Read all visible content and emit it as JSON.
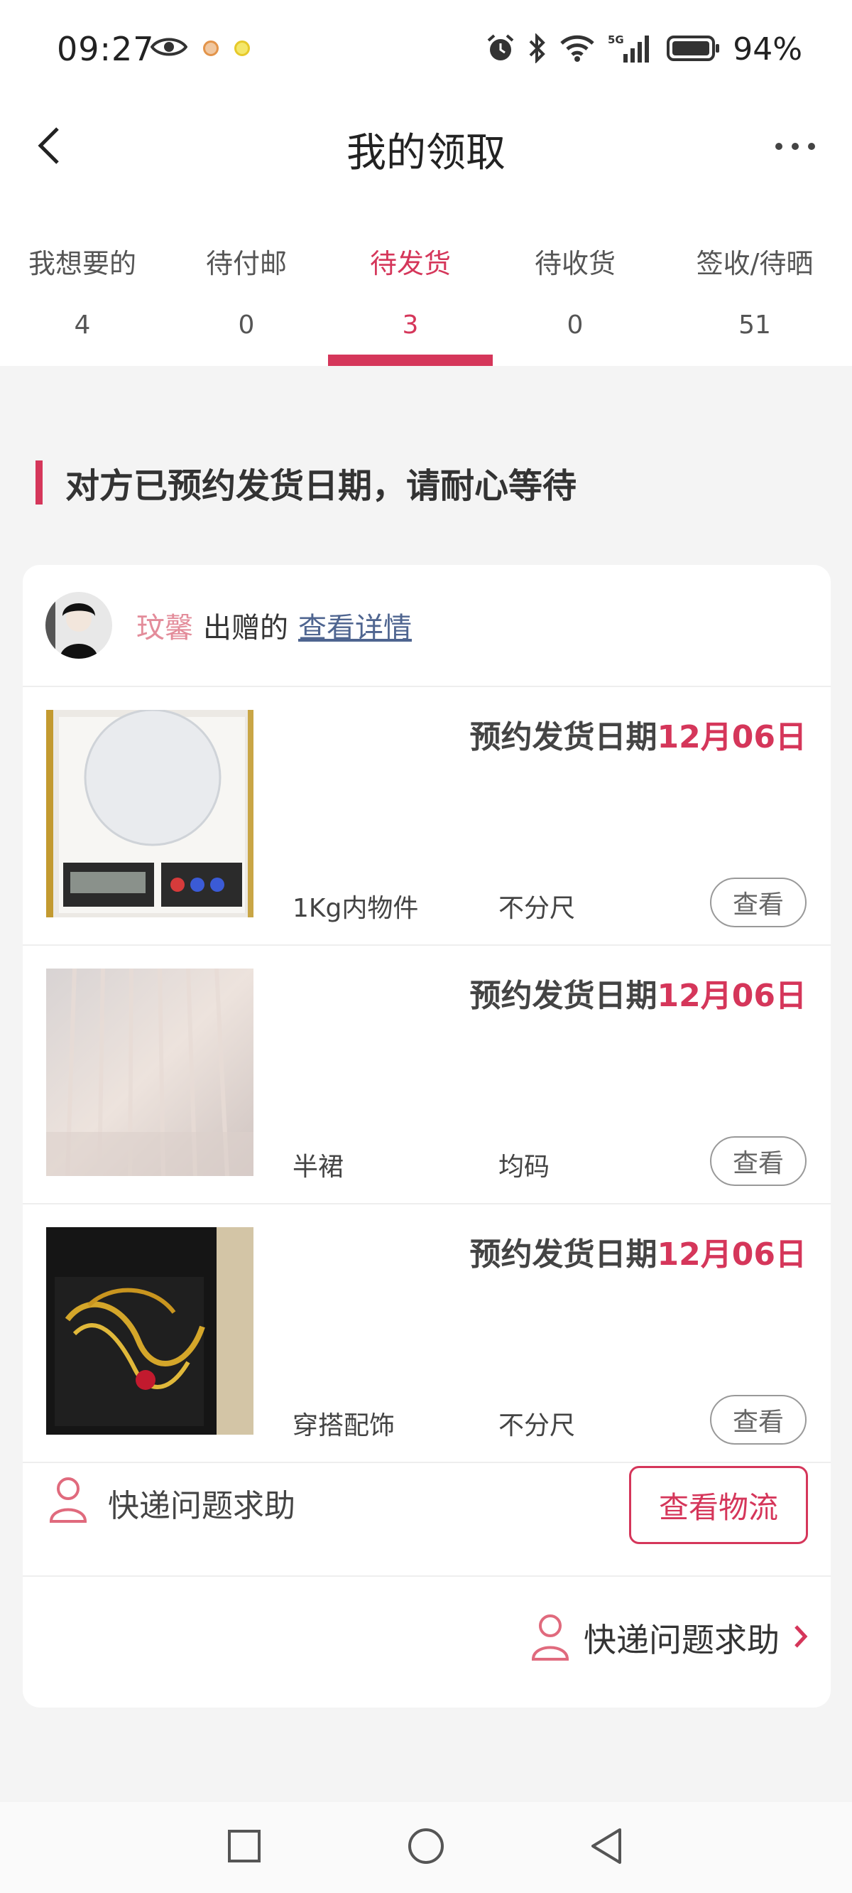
{
  "status_bar": {
    "time": "09:27",
    "battery": "94%",
    "network": "5G"
  },
  "header": {
    "title": "我的领取"
  },
  "tabs": [
    {
      "label": "我想要的",
      "count": "4"
    },
    {
      "label": "待付邮",
      "count": "0"
    },
    {
      "label": "待发货",
      "count": "3",
      "active": true
    },
    {
      "label": "待收货",
      "count": "0"
    },
    {
      "label": "签收/待晒",
      "count": "51"
    }
  ],
  "notice": {
    "text": "对方已预约发货日期，请耐心等待"
  },
  "order": {
    "donor_name": "玟馨",
    "donor_suffix": "出赠的",
    "detail_link": "查看详情",
    "items": [
      {
        "date_label": "预约发货日期",
        "date": "12月06日",
        "name": "1Kg内物件",
        "size": "不分尺",
        "view": "查看",
        "thumb": "kitchen-scale"
      },
      {
        "date_label": "预约发货日期",
        "date": "12月06日",
        "name": "半裙",
        "size": "均码",
        "view": "查看",
        "thumb": "tulle-skirt"
      },
      {
        "date_label": "预约发货日期",
        "date": "12月06日",
        "name": "穿搭配饰",
        "size": "不分尺",
        "view": "查看",
        "thumb": "gold-necklace"
      }
    ],
    "help_text": "快递问题求助",
    "logistics_button": "查看物流",
    "help_link": "快递问题求助"
  },
  "colors": {
    "accent": "#d5365a",
    "donor_name": "#e38c9a",
    "link": "#4f6590",
    "background": "#f4f4f4"
  }
}
